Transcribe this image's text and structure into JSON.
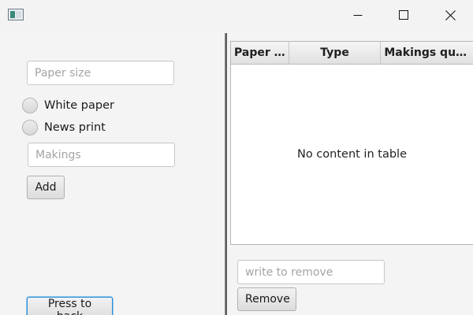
{
  "window": {
    "title": "",
    "icon": "java-app-icon"
  },
  "left_panel": {
    "paper_size_placeholder": "Paper size",
    "radio_white_paper": "White paper",
    "radio_news_print": "News print",
    "makings_placeholder": "Makings",
    "add_label": "Add",
    "back_label": "Press to back"
  },
  "right_panel": {
    "table": {
      "columns": [
        "Paper S...",
        "Type",
        "Makings qua..."
      ],
      "rows": [],
      "empty_text": "No content in table"
    },
    "remove_placeholder": "write to remove",
    "remove_label": "Remove"
  },
  "colors": {
    "focus_border": "#2f8fd6",
    "background": "#f4f4f4"
  }
}
